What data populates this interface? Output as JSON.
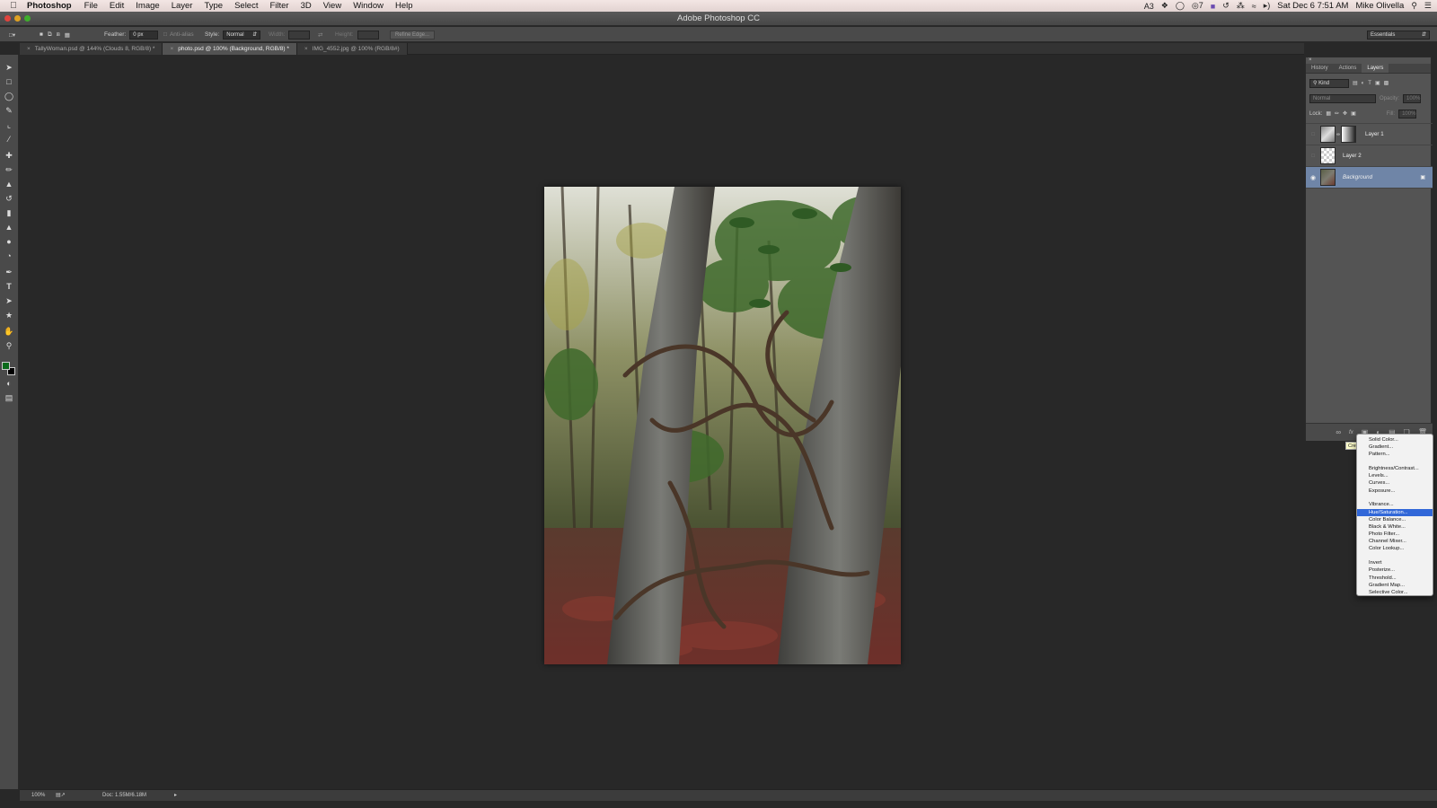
{
  "menubar": {
    "app": "Photoshop",
    "items": [
      "File",
      "Edit",
      "Image",
      "Layer",
      "Type",
      "Select",
      "Filter",
      "3D",
      "View",
      "Window",
      "Help"
    ],
    "status": [
      "3",
      "7"
    ],
    "datetime": "Sat Dec 6  7:51 AM",
    "user": "Mike Olivella"
  },
  "window": {
    "title": "Adobe Photoshop CC"
  },
  "options": {
    "feather_label": "Feather:",
    "feather_value": "0 px",
    "antialias": "Anti-alias",
    "style_label": "Style:",
    "style_value": "Normal",
    "width_label": "Width:",
    "height_label": "Height:",
    "refine_edge": "Refine Edge...",
    "workspace": "Essentials"
  },
  "doc_tabs": [
    {
      "label": "TallyWoman.psd @ 144% (Clouds 8, RGB/8) *"
    },
    {
      "label": "photo.psd @ 100% (Background, RGB/8) *"
    },
    {
      "label": "IMG_4552.jpg @ 100% (RGB/8#)"
    }
  ],
  "status": {
    "zoom": "100%",
    "doc": "Doc: 1.55M/6.18M"
  },
  "panel": {
    "tabs": [
      "History",
      "Actions",
      "Layers"
    ],
    "kind": "Kind",
    "blend": "Normal",
    "opacity_label": "Opacity:",
    "opacity_value": "100%",
    "lock_label": "Lock:",
    "fill_label": "Fill:",
    "fill_value": "100%",
    "layers": [
      {
        "name": "Layer 1"
      },
      {
        "name": "Layer 2"
      },
      {
        "name": "Background"
      }
    ]
  },
  "tooltip": "Cre",
  "adjust_menu": {
    "group1": [
      "Solid Color...",
      "Gradient...",
      "Pattern..."
    ],
    "group2": [
      "Brightness/Contrast...",
      "Levels...",
      "Curves...",
      "Exposure..."
    ],
    "group3": [
      "Vibrance...",
      "Hue/Saturation...",
      "Color Balance...",
      "Black & White...",
      "Photo Filter...",
      "Channel Mixer...",
      "Color Lookup..."
    ],
    "group4": [
      "Invert",
      "Posterize...",
      "Threshold...",
      "Gradient Map...",
      "Selective Color..."
    ],
    "highlighted": "Hue/Saturation..."
  },
  "colors": {
    "menu_highlight": "#3167d8",
    "layer_selected": "#6f85a7",
    "foreground": "#0a6a1a",
    "background": "#000000"
  }
}
